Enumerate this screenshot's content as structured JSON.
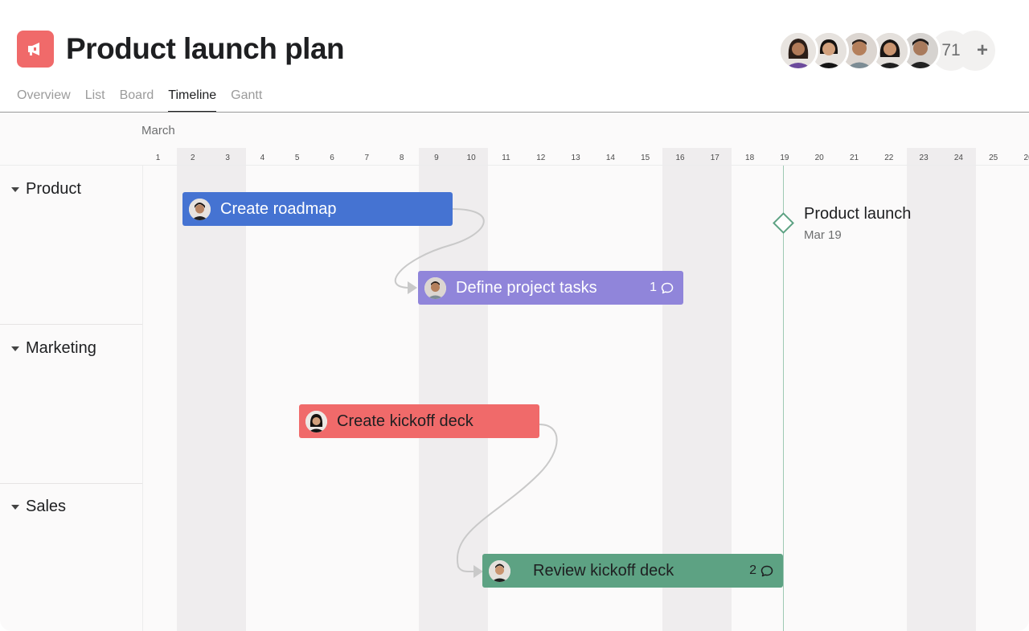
{
  "project": {
    "title": "Product launch plan",
    "icon": "megaphone-icon",
    "icon_color": "#f06a6a"
  },
  "tabs": [
    {
      "label": "Overview",
      "active": false
    },
    {
      "label": "List",
      "active": false
    },
    {
      "label": "Board",
      "active": false
    },
    {
      "label": "Timeline",
      "active": true
    },
    {
      "label": "Gantt",
      "active": false
    }
  ],
  "members": {
    "count": "71",
    "add_symbol": "+"
  },
  "timeline": {
    "month": "March",
    "days": [
      "1",
      "2",
      "3",
      "4",
      "5",
      "6",
      "7",
      "8",
      "9",
      "10",
      "11",
      "12",
      "13",
      "14",
      "15",
      "16",
      "17",
      "18",
      "19",
      "20",
      "21",
      "22",
      "23",
      "24",
      "25",
      "26"
    ]
  },
  "sections": [
    {
      "label": "Product"
    },
    {
      "label": "Marketing"
    },
    {
      "label": "Sales"
    }
  ],
  "tasks": [
    {
      "name": "Create roadmap",
      "color": "#4573d2",
      "text_color": "#ffffff",
      "comments": ""
    },
    {
      "name": "Define project tasks",
      "color": "#9085da",
      "text_color": "#ffffff",
      "comments": "1"
    },
    {
      "name": "Create kickoff deck",
      "color": "#f06a6a",
      "text_color": "#1e1f21",
      "comments": ""
    },
    {
      "name": "Review kickoff deck",
      "color": "#5da283",
      "text_color": "#1e1f21",
      "comments": "2"
    }
  ],
  "milestone": {
    "title": "Product launch",
    "date": "Mar 19"
  }
}
